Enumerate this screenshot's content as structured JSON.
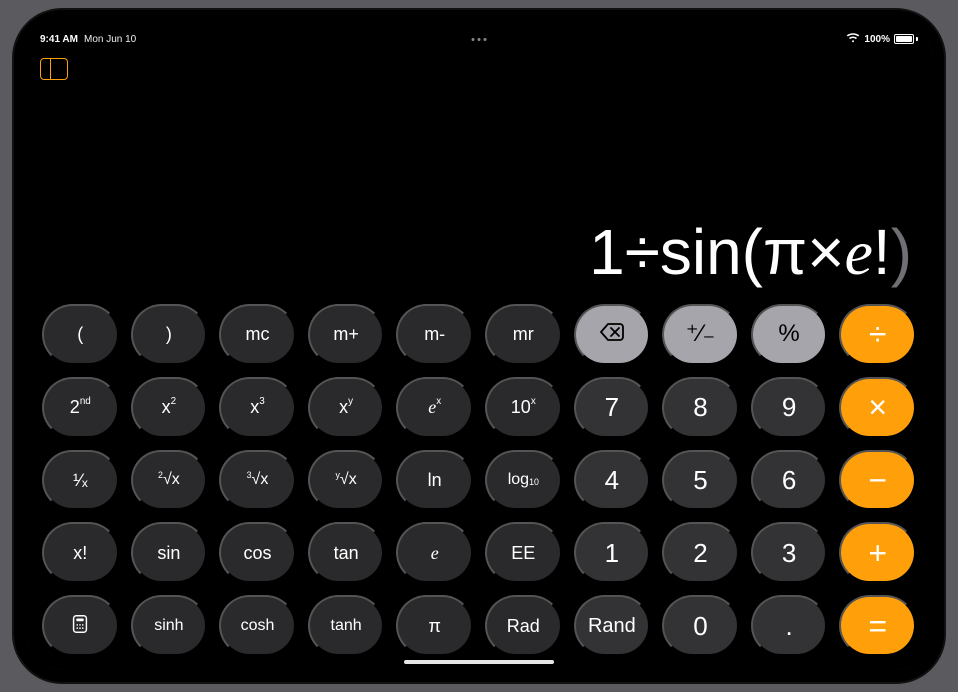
{
  "status": {
    "time": "9:41 AM",
    "date": "Mon Jun 10",
    "battery_percent": "100%"
  },
  "display": {
    "expression_plain": "1÷sin(π×e!)"
  },
  "keys": {
    "lparen": "(",
    "rparen": ")",
    "mc": "mc",
    "mplus": "m+",
    "mminus": "m-",
    "mr": "mr",
    "plusminus": "⁺∕₋",
    "percent": "%",
    "divide": "÷",
    "second_html": "2<sup>nd</sup>",
    "xsq_html": "x<sup>2</sup>",
    "xcu_html": "x<sup>3</sup>",
    "xpy_html": "x<sup>y</sup>",
    "expx_html": "<span class='it'>e</span><sup>x</sup>",
    "tenx_html": "10<sup>x</sup>",
    "d7": "7",
    "d8": "8",
    "d9": "9",
    "multiply": "×",
    "recip_html": "¹∕ₓ",
    "sqrt_html": "<sup>2</sup>√x",
    "cbrt_html": "<sup>3</sup>√x",
    "yroot_html": "<sup>y</sup>√x",
    "ln": "ln",
    "log10_html": "log<sub>10</sub>",
    "d4": "4",
    "d5": "5",
    "d6": "6",
    "minus": "−",
    "fact": "x!",
    "sin": "sin",
    "cos": "cos",
    "tan": "tan",
    "e_html": "<span class='it'>e</span>",
    "ee": "EE",
    "d1": "1",
    "d2": "2",
    "d3": "3",
    "plus": "+",
    "sinh": "sinh",
    "cosh": "cosh",
    "tanh": "tanh",
    "pi": "π",
    "rad": "Rad",
    "rand": "Rand",
    "d0": "0",
    "dot": ".",
    "equals": "="
  }
}
